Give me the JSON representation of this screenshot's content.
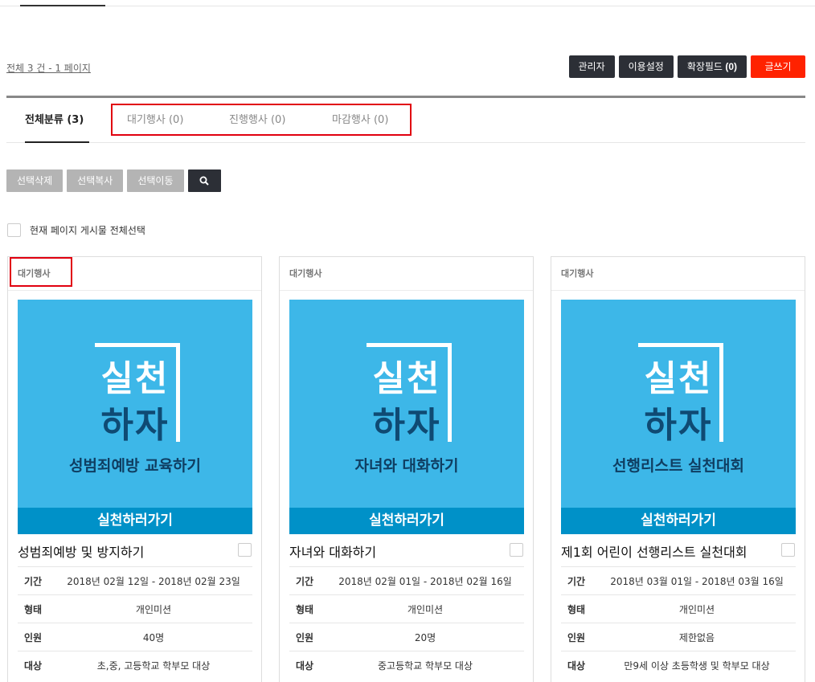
{
  "count_info": "전체 3 건 - 1 페이지",
  "admin_buttons": {
    "admin": "관리자",
    "settings": "이용설정",
    "ext_field": "확장필드",
    "ext_field_count": "(0)",
    "write": "글쓰기"
  },
  "tabs": [
    {
      "label": "전체분류 (3)"
    },
    {
      "label": "대기행사 (0)"
    },
    {
      "label": "진행행사 (0)"
    },
    {
      "label": "마감행사 (0)"
    }
  ],
  "actions": {
    "delete": "선택삭제",
    "copy": "선택복사",
    "move": "선택이동"
  },
  "select_all_label": "현재 페이지 게시물 전체선택",
  "thumb_common": {
    "line1": "실천",
    "line2": "하자",
    "bar": "실천하러가기"
  },
  "labels": {
    "period": "기간",
    "type": "형태",
    "people": "인원",
    "target": "대상"
  },
  "cards": [
    {
      "status": "대기행사",
      "thumb_subtitle": "성범죄예방 교육하기",
      "title": "성범죄예방 및 방지하기",
      "period": "2018년 02월 12일 - 2018년 02월 23일",
      "type": "개인미션",
      "people": "40명",
      "target": "초,중, 고등학교 학부모 대상"
    },
    {
      "status": "대기행사",
      "thumb_subtitle": "자녀와 대화하기",
      "title": "자녀와 대화하기",
      "period": "2018년 02월 01일 - 2018년 02월 16일",
      "type": "개인미션",
      "people": "20명",
      "target": "중고등학교 학부모 대상"
    },
    {
      "status": "대기행사",
      "thumb_subtitle": "선행리스트 실천대회",
      "title": "제1회 어린이 선행리스트 실천대회",
      "period": "2018년 03월 01일 - 2018년 03월 16일",
      "type": "개인미션",
      "people": "제한없음",
      "target": "만9세 이상 초등학생 및 학부모 대상"
    }
  ],
  "colors": {
    "thumb_bg": "#3db7e8",
    "thumb_bar": "#0091c8",
    "write_button": "#ff2200",
    "dark_button": "#2c2f36",
    "highlight": "#e1000f"
  }
}
